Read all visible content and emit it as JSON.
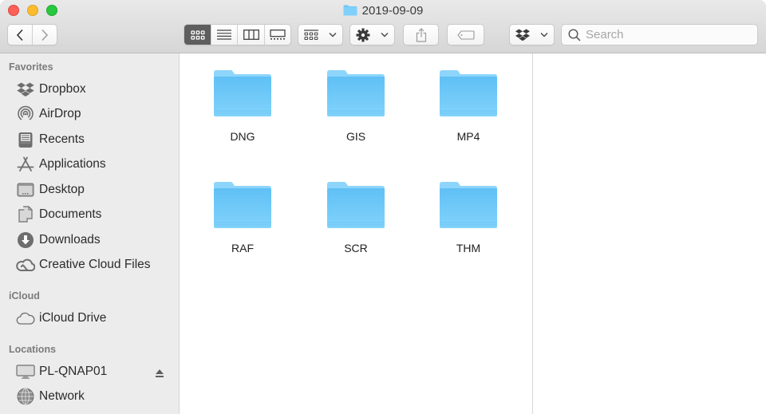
{
  "window": {
    "title": "2019-09-09",
    "title_icon": "folder-icon"
  },
  "toolbar": {
    "back_icon": "chevron-left-icon",
    "forward_icon": "chevron-right-icon",
    "view_modes": [
      {
        "name": "icon-view",
        "icon": "grid-icon",
        "active": true
      },
      {
        "name": "list-view",
        "icon": "list-icon",
        "active": false
      },
      {
        "name": "column-view",
        "icon": "columns-icon",
        "active": false
      },
      {
        "name": "gallery-view",
        "icon": "gallery-icon",
        "active": false
      }
    ],
    "arrange_icon": "group-icon",
    "action_icon": "gear-icon",
    "share_icon": "share-icon",
    "tag_icon": "tag-icon",
    "dropbox_icon": "dropbox-icon",
    "search_placeholder": "Search",
    "search_value": ""
  },
  "sidebar": {
    "sections": [
      {
        "header": "Favorites",
        "items": [
          {
            "label": "Dropbox",
            "icon": "dropbox-icon"
          },
          {
            "label": "AirDrop",
            "icon": "airdrop-icon"
          },
          {
            "label": "Recents",
            "icon": "recents-icon"
          },
          {
            "label": "Applications",
            "icon": "applications-icon"
          },
          {
            "label": "Desktop",
            "icon": "desktop-icon"
          },
          {
            "label": "Documents",
            "icon": "documents-icon"
          },
          {
            "label": "Downloads",
            "icon": "downloads-icon"
          },
          {
            "label": "Creative Cloud Files",
            "icon": "creative-cloud-icon"
          }
        ]
      },
      {
        "header": "iCloud",
        "items": [
          {
            "label": "iCloud Drive",
            "icon": "cloud-icon"
          }
        ]
      },
      {
        "header": "Locations",
        "items": [
          {
            "label": "PL-QNAP01",
            "icon": "computer-icon",
            "ejectable": true
          },
          {
            "label": "Network",
            "icon": "network-icon"
          }
        ]
      }
    ]
  },
  "content": {
    "folders": [
      {
        "name": "DNG"
      },
      {
        "name": "GIS"
      },
      {
        "name": "MP4"
      },
      {
        "name": "RAF"
      },
      {
        "name": "SCR"
      },
      {
        "name": "THM"
      }
    ]
  },
  "colors": {
    "folder_light": "#8dd5fb",
    "folder_dark": "#5fc0f5",
    "active_segment": "#5e5e5e",
    "sidebar_bg": "#ececec"
  }
}
